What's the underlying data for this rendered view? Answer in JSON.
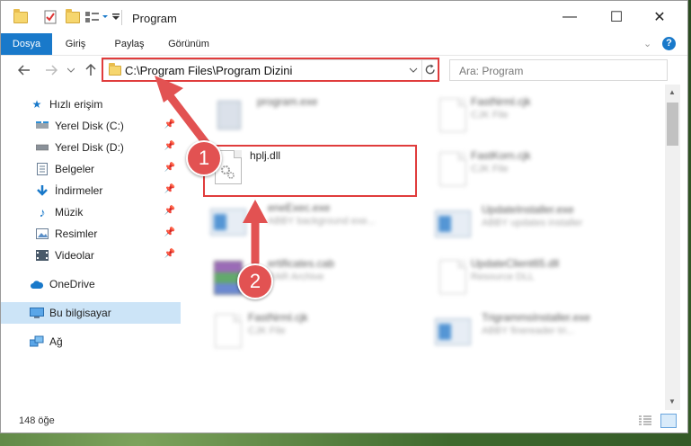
{
  "window": {
    "title": "Program",
    "controls": {
      "minimize": "—",
      "maximize": "☐",
      "close": "✕"
    }
  },
  "ribbon": {
    "tabs": [
      {
        "label": "Dosya"
      },
      {
        "label": "Giriş"
      },
      {
        "label": "Paylaş"
      },
      {
        "label": "Görünüm"
      }
    ]
  },
  "nav": {
    "address": "C:\\Program Files\\Program Dizini",
    "search_placeholder": "Ara: Program"
  },
  "sidebar": {
    "items": [
      {
        "label": "Hızlı erişim",
        "icon": "star-icon"
      },
      {
        "label": "Yerel Disk (C:)",
        "icon": "drive-icon"
      },
      {
        "label": "Yerel Disk (D:)",
        "icon": "drive-icon"
      },
      {
        "label": "Belgeler",
        "icon": "documents-icon"
      },
      {
        "label": "İndirmeler",
        "icon": "download-icon"
      },
      {
        "label": "Müzik",
        "icon": "music-icon"
      },
      {
        "label": "Resimler",
        "icon": "pictures-icon"
      },
      {
        "label": "Videolar",
        "icon": "video-icon"
      },
      {
        "label": "OneDrive",
        "icon": "cloud-icon"
      },
      {
        "label": "Bu bilgisayar",
        "icon": "computer-icon"
      },
      {
        "label": "Ağ",
        "icon": "network-icon"
      }
    ]
  },
  "files": {
    "left": [
      {
        "name": "program.exe",
        "type": ""
      },
      {
        "name": "hplj.dll",
        "type": ""
      },
      {
        "name": "eneExec.exe",
        "type": "ABBY background exe..."
      },
      {
        "name": "ertificates.cab",
        "type": "RAR Archive"
      },
      {
        "name": "FastNrml.cjk",
        "type": "CJK File"
      }
    ],
    "right": [
      {
        "name": "FastNrml.cjk",
        "type": "CJK File"
      },
      {
        "name": "FastKorn.cjk",
        "type": "CJK File"
      },
      {
        "name": "UpdateInstaller.exe",
        "type": "ABBY updates installer"
      },
      {
        "name": "UpdateClient65.dll",
        "type": "Resource DLL"
      },
      {
        "name": "TrigrammsInstaller.exe",
        "type": "ABBY finereader tri..."
      }
    ]
  },
  "annotations": {
    "step1": "1",
    "step2": "2"
  },
  "status": {
    "count": "148 öğe"
  },
  "colors": {
    "accent": "#1979ca",
    "highlight": "#e03c3c",
    "badge": "#e25252"
  }
}
